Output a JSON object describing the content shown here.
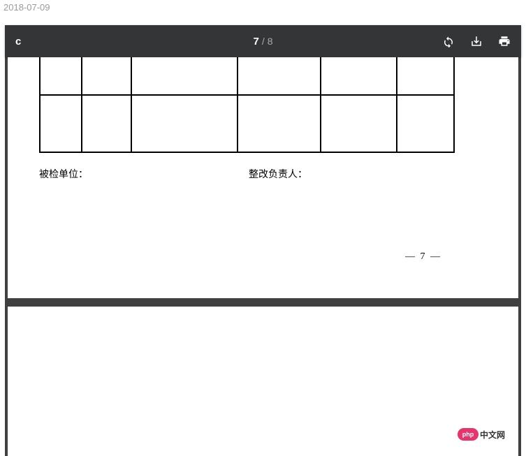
{
  "header_date": "2018-07-09",
  "toolbar": {
    "doc_label": "c",
    "page_current": "7",
    "page_separator": "/",
    "page_total": "8"
  },
  "document": {
    "label_inspected_unit": "被检单位：",
    "label_rectification_person": "整改负责人：",
    "page_number_text": "— 7 —"
  },
  "watermark": {
    "badge": "php",
    "text": "中文网"
  }
}
